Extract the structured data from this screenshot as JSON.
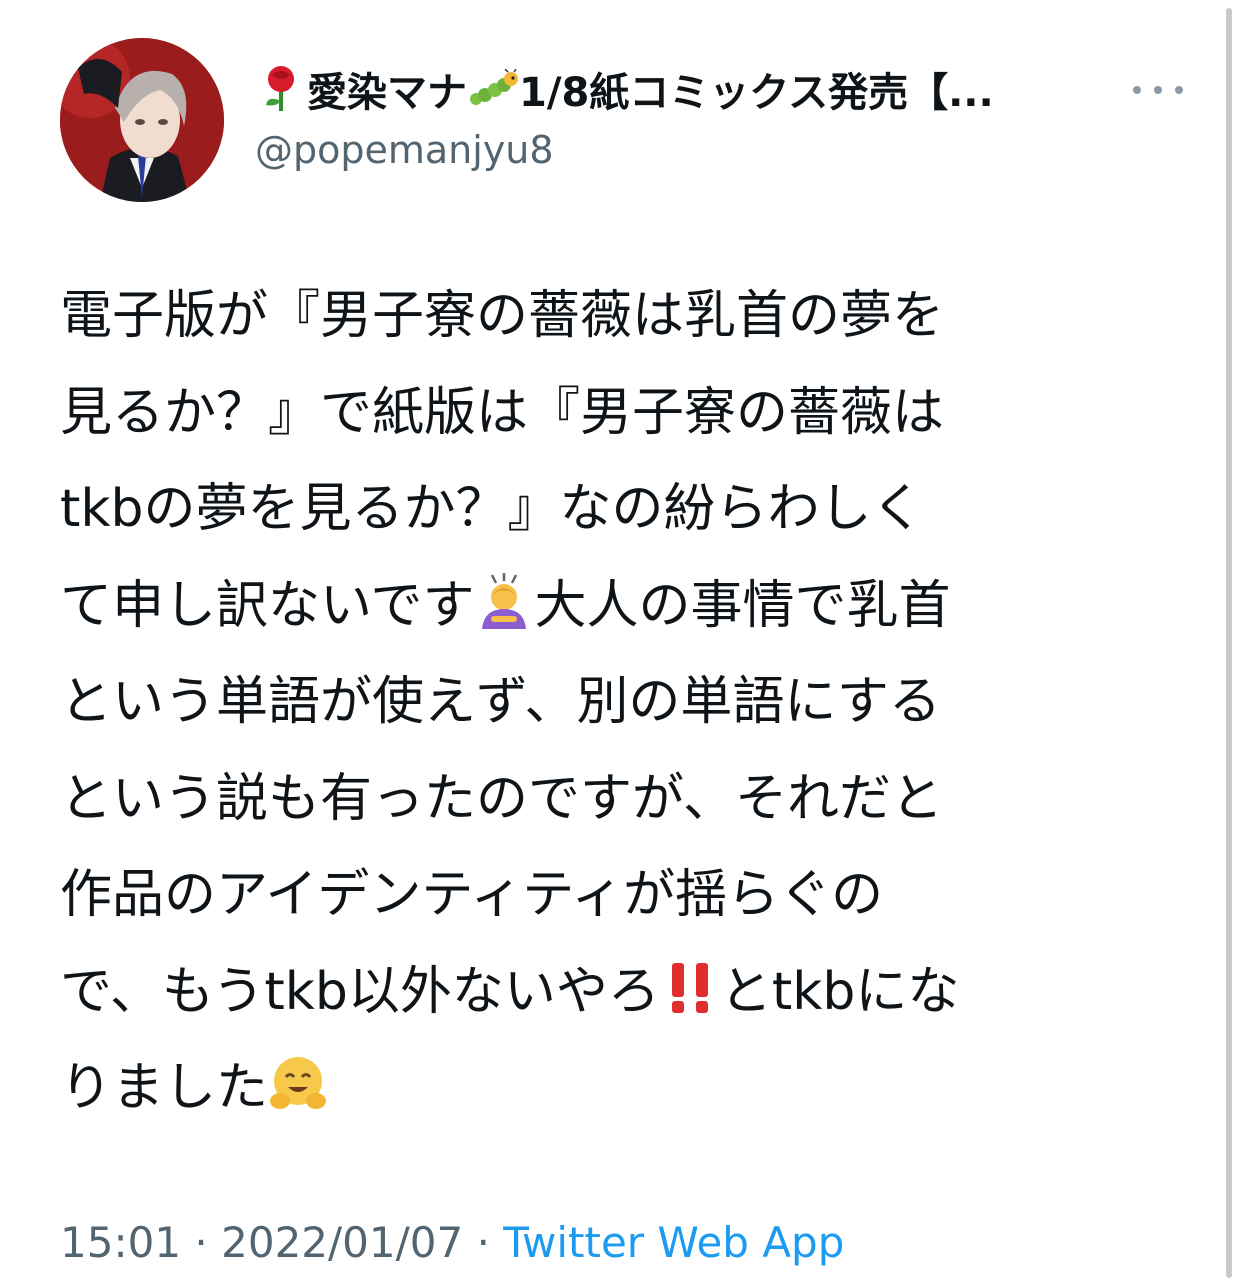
{
  "tweet": {
    "display_name_prefix": "愛染マナ",
    "display_name_suffix": "1/8紙コミックス発売【...",
    "handle": "@popemanjyu8",
    "lines": [
      "電子版が『男子寮の薔薇は乳首の夢を",
      "見るか？』で紙版は『男子寮の薔薇は",
      "tkbの夢を見るか？』なの紛らわしく",
      "て申し訳ないです",
      "大人の事情で乳首",
      "という単語が使えず、別の単語にする",
      "という説も有ったのですが、それだと",
      "作品のアイデンティティが揺らぐの",
      "で、もうtkb以外ないやろ",
      "とtkbにな",
      "りました"
    ],
    "time": "15:01",
    "separator": "·",
    "date": "2022/01/07",
    "source": "Twitter Web App"
  },
  "icons": {
    "name_emoji_1": "rose-icon",
    "name_emoji_2": "caterpillar-icon",
    "body_emoji_1": "person-bowing-icon",
    "body_emoji_2": "double-exclamation-icon",
    "body_emoji_3": "hugging-face-icon"
  },
  "colors": {
    "text": "#0f1419",
    "secondary": "#536471",
    "link": "#1d9bf0",
    "background": "#ffffff"
  }
}
